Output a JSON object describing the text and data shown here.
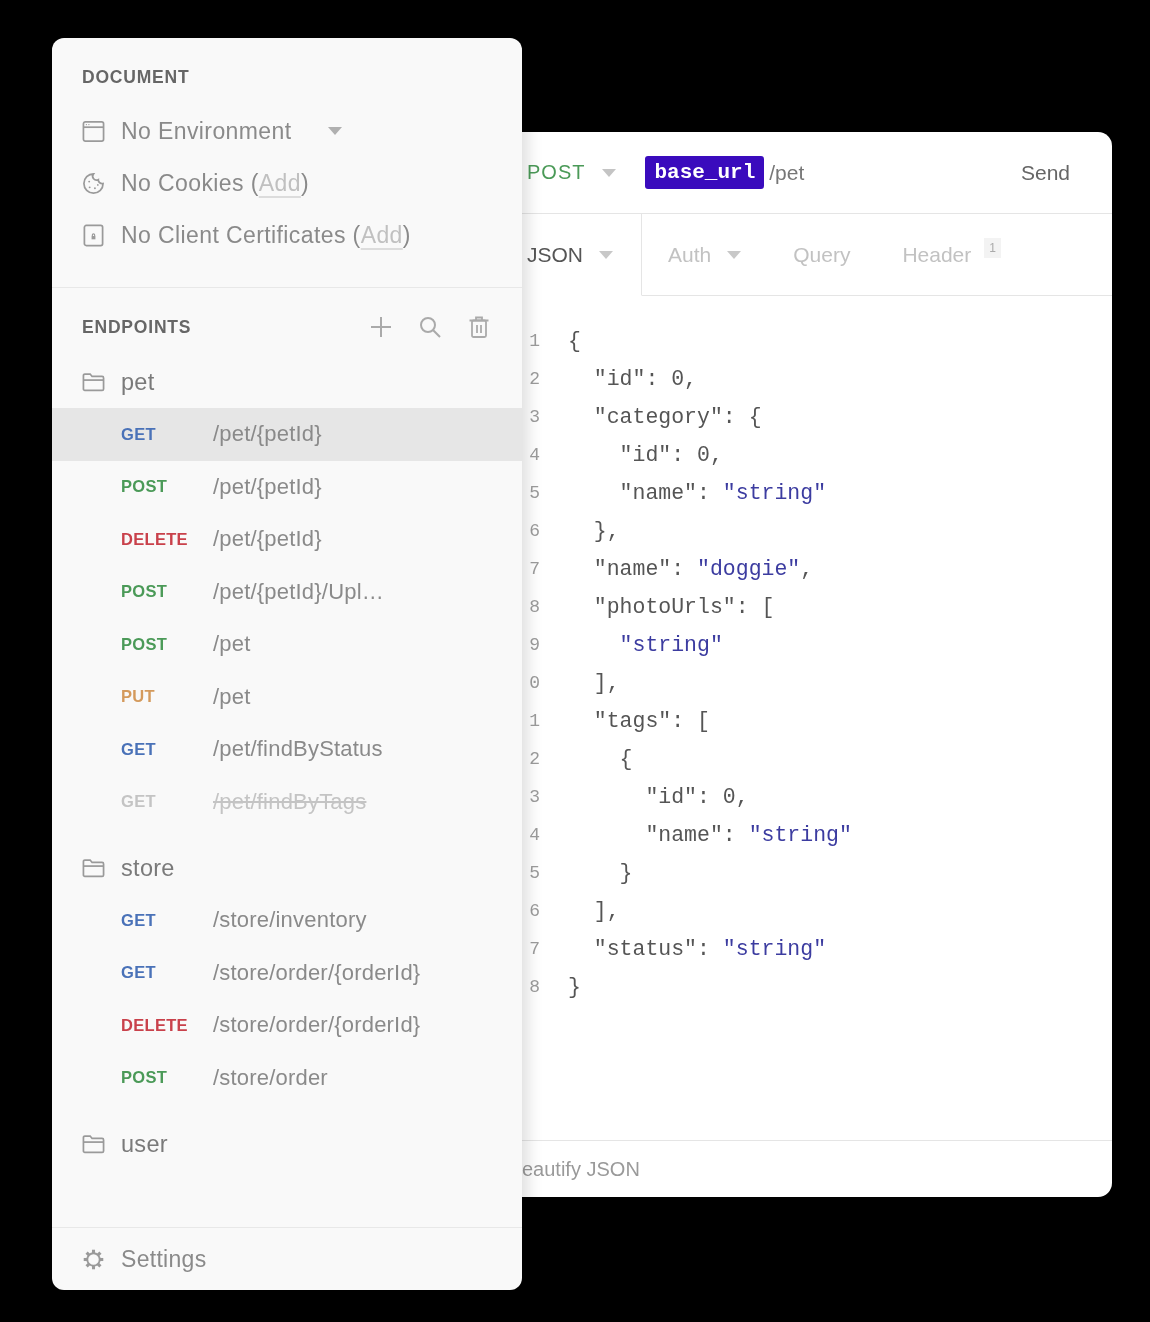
{
  "document": {
    "title": "DOCUMENT",
    "items": [
      {
        "kind": "environment",
        "dropdown": true,
        "text": "No Environment"
      },
      {
        "kind": "cookies",
        "dropdown": false,
        "text": "No Cookies (",
        "link": "Add",
        "text_after": ")"
      },
      {
        "kind": "certificates",
        "dropdown": false,
        "text": "No Client Certificates (",
        "link": "Add",
        "text_after": ")"
      }
    ]
  },
  "endpoints": {
    "title": "ENDPOINTS",
    "folders": [
      {
        "name": "pet",
        "children": [
          {
            "method": "GET",
            "color": "#4a72b8",
            "path": "/pet/{petId}",
            "selected": true,
            "deprecated": false
          },
          {
            "method": "POST",
            "color": "#4b9a58",
            "path": "/pet/{petId}",
            "selected": false,
            "deprecated": false
          },
          {
            "method": "DELETE",
            "color": "#c9414b",
            "path": "/pet/{petId}",
            "selected": false,
            "deprecated": false
          },
          {
            "method": "POST",
            "color": "#4b9a58",
            "path": "/pet/{petId}/Upl…",
            "selected": false,
            "deprecated": false
          },
          {
            "method": "POST",
            "color": "#4b9a58",
            "path": "/pet",
            "selected": false,
            "deprecated": false
          },
          {
            "method": "PUT",
            "color": "#d49a5c",
            "path": "/pet",
            "selected": false,
            "deprecated": false
          },
          {
            "method": "GET",
            "color": "#4a72b8",
            "path": "/pet/findByStatus",
            "selected": false,
            "deprecated": false
          },
          {
            "method": "GET",
            "color": "#c4c4c4",
            "path": "/pet/findByTags",
            "selected": false,
            "deprecated": true
          }
        ]
      },
      {
        "name": "store",
        "children": [
          {
            "method": "GET",
            "color": "#4a72b8",
            "path": "/store/inventory",
            "selected": false,
            "deprecated": false
          },
          {
            "method": "GET",
            "color": "#4a72b8",
            "path": "/store/order/{orderId}",
            "selected": false,
            "deprecated": false
          },
          {
            "method": "DELETE",
            "color": "#c9414b",
            "path": "/store/order/{orderId}",
            "selected": false,
            "deprecated": false
          },
          {
            "method": "POST",
            "color": "#4b9a58",
            "path": "/store/order",
            "selected": false,
            "deprecated": false
          }
        ]
      },
      {
        "name": "user"
      }
    ]
  },
  "settings": {
    "label": "Settings"
  },
  "request": {
    "method": "POST",
    "variable": "base_url",
    "path": "/pet",
    "send": "Send"
  },
  "tabs": [
    {
      "label": "JSON",
      "dropdown": true,
      "selected": true
    },
    {
      "label": "Auth",
      "dropdown": true,
      "selected": false
    },
    {
      "label": "Query",
      "dropdown": false,
      "selected": false
    },
    {
      "label": "Header",
      "dropdown": false,
      "badge": "1",
      "selected": false
    }
  ],
  "editor": {
    "lines": [
      {
        "number": "1",
        "parts": [
          {
            "kind": "plain",
            "text": "{"
          }
        ]
      },
      {
        "number": "2",
        "parts": [
          {
            "kind": "plain",
            "text": "  \"id\": 0,"
          }
        ]
      },
      {
        "number": "3",
        "parts": [
          {
            "kind": "plain",
            "text": "  \"category\": {"
          }
        ]
      },
      {
        "number": "4",
        "parts": [
          {
            "kind": "plain",
            "text": "    \"id\": 0,"
          }
        ]
      },
      {
        "number": "5",
        "parts": [
          {
            "kind": "plain",
            "text": "    \"name\": "
          },
          {
            "kind": "string",
            "text": "\"string\""
          }
        ]
      },
      {
        "number": "6",
        "parts": [
          {
            "kind": "plain",
            "text": "  },"
          }
        ]
      },
      {
        "number": "7",
        "parts": [
          {
            "kind": "plain",
            "text": "  \"name\": "
          },
          {
            "kind": "string",
            "text": "\"doggie\""
          },
          {
            "kind": "plain",
            "text": ","
          }
        ]
      },
      {
        "number": "8",
        "parts": [
          {
            "kind": "plain",
            "text": "  \"photoUrls\": ["
          }
        ]
      },
      {
        "number": "9",
        "parts": [
          {
            "kind": "string",
            "text": "    \"string\""
          }
        ]
      },
      {
        "number": "0",
        "parts": [
          {
            "kind": "plain",
            "text": "  ],"
          }
        ]
      },
      {
        "number": "1",
        "parts": [
          {
            "kind": "plain",
            "text": "  \"tags\": ["
          }
        ]
      },
      {
        "number": "2",
        "parts": [
          {
            "kind": "plain",
            "text": "    {"
          }
        ]
      },
      {
        "number": "3",
        "parts": [
          {
            "kind": "plain",
            "text": "      \"id\": 0,"
          }
        ]
      },
      {
        "number": "4",
        "parts": [
          {
            "kind": "plain",
            "text": "      \"name\": "
          },
          {
            "kind": "string",
            "text": "\"string\""
          }
        ]
      },
      {
        "number": "5",
        "parts": [
          {
            "kind": "plain",
            "text": "    }"
          }
        ]
      },
      {
        "number": "6",
        "parts": [
          {
            "kind": "plain",
            "text": "  ],"
          }
        ]
      },
      {
        "number": "7",
        "parts": [
          {
            "kind": "plain",
            "text": "  \"status\": "
          },
          {
            "kind": "string",
            "text": "\"string\""
          }
        ]
      },
      {
        "number": "8",
        "parts": [
          {
            "kind": "plain",
            "text": "}"
          }
        ]
      }
    ]
  },
  "footer": {
    "action": "eautify JSON"
  }
}
